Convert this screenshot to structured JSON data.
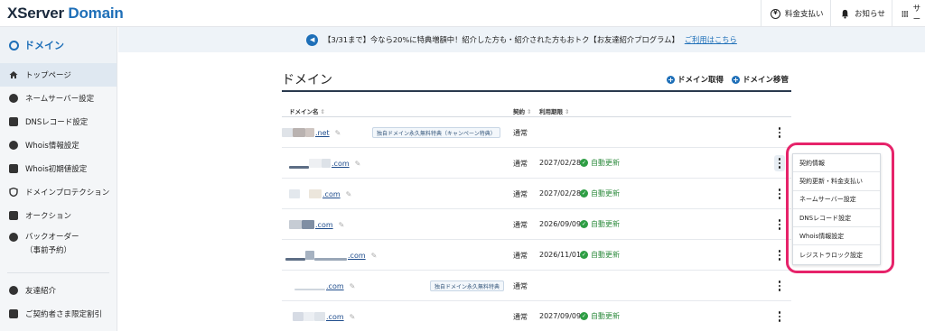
{
  "header": {
    "logo_x": "XServer",
    "logo_domain": " Domain",
    "payment_label": "料金支払い",
    "news_label": "お知らせ",
    "services_label": "サー"
  },
  "sidebar": {
    "section_title": "ドメイン",
    "items": [
      {
        "label": "トップページ",
        "icon": "home-icon"
      },
      {
        "label": "ネームサーバー設定",
        "icon": "globe-icon"
      },
      {
        "label": "DNSレコード設定",
        "icon": "server-icon"
      },
      {
        "label": "Whois情報設定",
        "icon": "whois-icon"
      },
      {
        "label": "Whois初期値設定",
        "icon": "document-icon"
      },
      {
        "label": "ドメインプロテクション",
        "icon": "shield-icon"
      },
      {
        "label": "オークション",
        "icon": "gavel-icon"
      },
      {
        "label_line1": "バックオーダー",
        "label_line2": "（事前予約）",
        "icon": "backorder-icon"
      },
      {
        "label": "友達紹介",
        "icon": "user-icon"
      },
      {
        "label": "ご契約者さま限定割引",
        "icon": "discount-icon"
      }
    ]
  },
  "notice": {
    "text": "【3/31まで】今なら20%に特典増額中！紹介した方も・紹介された方もおトク【お友達紹介プログラム】",
    "link": "ご利用はこちら"
  },
  "main": {
    "title": "ドメイン",
    "acquire_label": "ドメイン取得",
    "transfer_label": "ドメイン移管",
    "columns": {
      "domain": "ドメイン名",
      "contract": "契約",
      "expiry": "利用期限"
    },
    "rows": [
      {
        "tld": ".net",
        "promo": "独自ドメイン永久無料特典（キャンペーン特典）",
        "contract": "通常",
        "expiry": "",
        "auto": ""
      },
      {
        "tld": ".com",
        "promo": "",
        "contract": "通常",
        "expiry": "2027/02/28",
        "auto": "自動更新"
      },
      {
        "tld": ".com",
        "promo": "",
        "contract": "通常",
        "expiry": "2027/02/28",
        "auto": "自動更新"
      },
      {
        "tld": ".com",
        "promo": "",
        "contract": "通常",
        "expiry": "2026/09/09",
        "auto": "自動更新"
      },
      {
        "tld": ".com",
        "promo": "",
        "contract": "通常",
        "expiry": "2026/11/01",
        "auto": "自動更新"
      },
      {
        "tld": ".com",
        "promo": "独自ドメイン永久無料特典",
        "contract": "通常",
        "expiry": "",
        "auto": ""
      },
      {
        "tld": ".com",
        "promo": "",
        "contract": "通常",
        "expiry": "2027/09/09",
        "auto": "自動更新"
      }
    ]
  },
  "dropdown": {
    "items": [
      "契約情報",
      "契約更新・料金支払い",
      "ネームサーバー設定",
      "DNSレコード設定",
      "Whois情報設定",
      "レジストラロック設定"
    ]
  },
  "colors": {
    "brand": "#1e6fb8",
    "highlight": "#e6236a",
    "auto_renew": "#2e8b3e"
  }
}
